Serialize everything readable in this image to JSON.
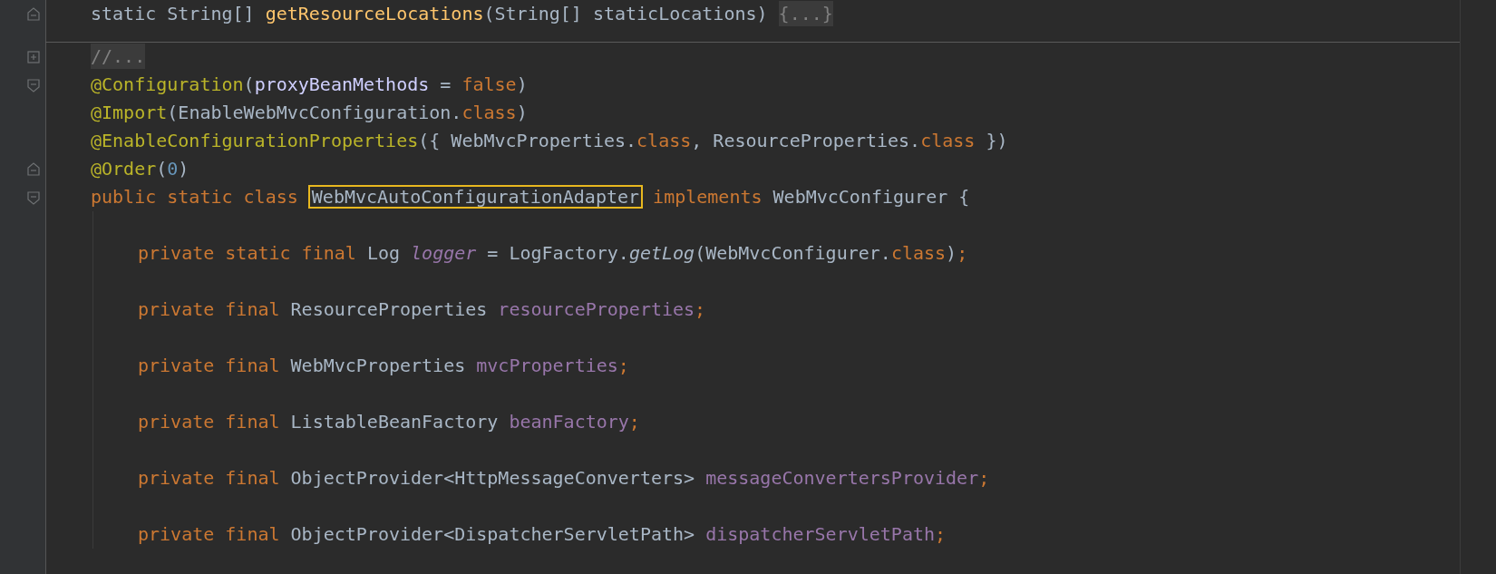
{
  "editor": {
    "lines": [
      {
        "fold_marker": {
          "kind": "end"
        },
        "separator_after": true,
        "tokens": [
          {
            "kind": "plain",
            "text": "static String[] "
          },
          {
            "kind": "method_decl",
            "text": "getResourceLocations"
          },
          {
            "kind": "plain",
            "text": "(String[] staticLocations) "
          },
          {
            "kind": "folded",
            "text": "{...}"
          }
        ]
      },
      {
        "fold_marker": {
          "kind": "start",
          "collapsed": true
        },
        "tokens": [
          {
            "kind": "folded",
            "text": "//..."
          }
        ]
      },
      {
        "fold_marker": {
          "kind": "start",
          "collapsed": false
        },
        "tokens": [
          {
            "kind": "annotation",
            "text": "@Configuration"
          },
          {
            "kind": "plain",
            "text": "("
          },
          {
            "kind": "param",
            "text": "proxyBeanMethods"
          },
          {
            "kind": "plain",
            "text": " = "
          },
          {
            "kind": "keyword",
            "text": "false"
          },
          {
            "kind": "plain",
            "text": ")"
          }
        ]
      },
      {
        "tokens": [
          {
            "kind": "annotation",
            "text": "@Import"
          },
          {
            "kind": "plain",
            "text": "(EnableWebMvcConfiguration."
          },
          {
            "kind": "keyword",
            "text": "class"
          },
          {
            "kind": "plain",
            "text": ")"
          }
        ]
      },
      {
        "tokens": [
          {
            "kind": "annotation",
            "text": "@EnableConfigurationProperties"
          },
          {
            "kind": "plain",
            "text": "({ WebMvcProperties."
          },
          {
            "kind": "keyword",
            "text": "class"
          },
          {
            "kind": "plain",
            "text": ", ResourceProperties."
          },
          {
            "kind": "keyword",
            "text": "class"
          },
          {
            "kind": "plain",
            "text": " })"
          }
        ]
      },
      {
        "fold_marker": {
          "kind": "end"
        },
        "tokens": [
          {
            "kind": "annotation",
            "text": "@Order"
          },
          {
            "kind": "plain",
            "text": "("
          },
          {
            "kind": "number",
            "text": "0"
          },
          {
            "kind": "plain",
            "text": ")"
          }
        ]
      },
      {
        "fold_marker": {
          "kind": "start",
          "collapsed": false
        },
        "tokens": [
          {
            "kind": "keyword",
            "text": "public static class "
          },
          {
            "kind": "highlight",
            "text": "WebMvcAutoConfigurationAdapter"
          },
          {
            "kind": "keyword",
            "text": " implements "
          },
          {
            "kind": "plain",
            "text": "WebMvcConfigurer {"
          }
        ],
        "children": [
          {
            "tokens": [
              {
                "kind": "keyword",
                "text": "private static final "
              },
              {
                "kind": "plain",
                "text": "Log "
              },
              {
                "kind": "static_field",
                "text": "logger"
              },
              {
                "kind": "plain",
                "text": " = LogFactory."
              },
              {
                "kind": "static_call",
                "text": "getLog"
              },
              {
                "kind": "plain",
                "text": "(WebMvcConfigurer."
              },
              {
                "kind": "keyword",
                "text": "class"
              },
              {
                "kind": "plain",
                "text": ")"
              },
              {
                "kind": "keyword",
                "text": ";"
              }
            ]
          },
          {
            "tokens": [
              {
                "kind": "keyword",
                "text": "private final "
              },
              {
                "kind": "plain",
                "text": "ResourceProperties "
              },
              {
                "kind": "field",
                "text": "resourceProperties"
              },
              {
                "kind": "keyword",
                "text": ";"
              }
            ]
          },
          {
            "tokens": [
              {
                "kind": "keyword",
                "text": "private final "
              },
              {
                "kind": "plain",
                "text": "WebMvcProperties "
              },
              {
                "kind": "field",
                "text": "mvcProperties"
              },
              {
                "kind": "keyword",
                "text": ";"
              }
            ]
          },
          {
            "tokens": [
              {
                "kind": "keyword",
                "text": "private final "
              },
              {
                "kind": "plain",
                "text": "ListableBeanFactory "
              },
              {
                "kind": "field",
                "text": "beanFactory"
              },
              {
                "kind": "keyword",
                "text": ";"
              }
            ]
          },
          {
            "tokens": [
              {
                "kind": "keyword",
                "text": "private final "
              },
              {
                "kind": "plain",
                "text": "ObjectProvider<HttpMessageConverters> "
              },
              {
                "kind": "field",
                "text": "messageConvertersProvider"
              },
              {
                "kind": "keyword",
                "text": ";"
              }
            ]
          },
          {
            "tokens": [
              {
                "kind": "keyword",
                "text": "private final "
              },
              {
                "kind": "plain",
                "text": "ObjectProvider<DispatcherServletPath> "
              },
              {
                "kind": "field",
                "text": "dispatcherServletPath"
              },
              {
                "kind": "keyword",
                "text": ";"
              }
            ]
          }
        ]
      }
    ]
  }
}
